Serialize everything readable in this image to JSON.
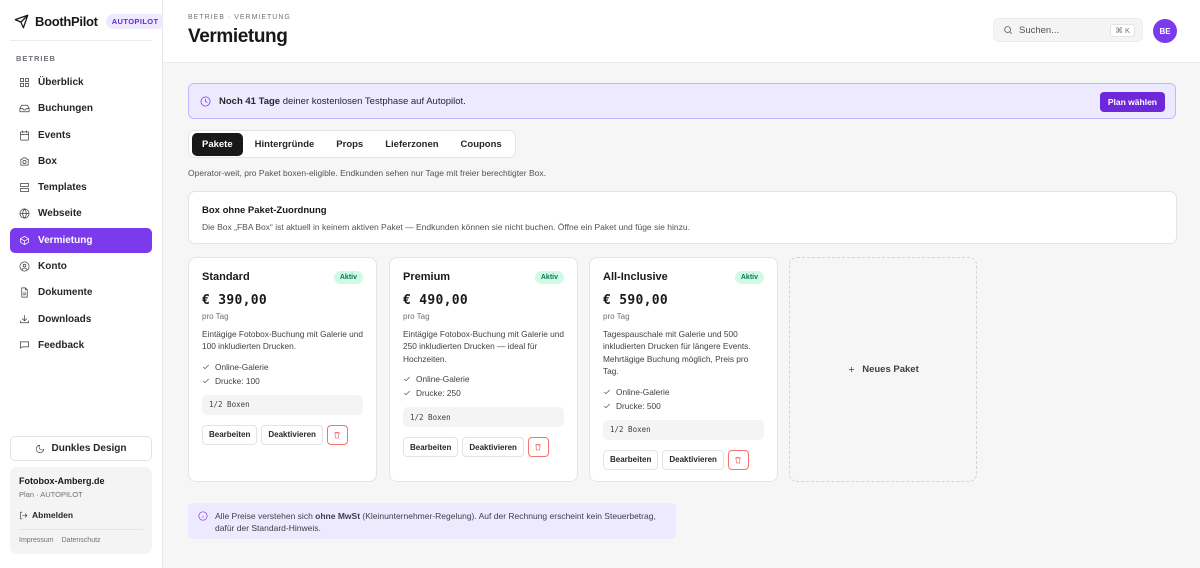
{
  "brand": {
    "name": "BoothPilot",
    "badge": "AUTOPILOT"
  },
  "sidebar": {
    "section": "BETRIEB",
    "items": [
      {
        "label": "Überblick",
        "icon": "grid-icon"
      },
      {
        "label": "Buchungen",
        "icon": "inbox-icon"
      },
      {
        "label": "Events",
        "icon": "calendar-icon"
      },
      {
        "label": "Box",
        "icon": "camera-icon"
      },
      {
        "label": "Templates",
        "icon": "layout-icon"
      },
      {
        "label": "Webseite",
        "icon": "globe-icon"
      },
      {
        "label": "Vermietung",
        "icon": "package-icon",
        "active": true
      },
      {
        "label": "Konto",
        "icon": "user-icon"
      },
      {
        "label": "Dokumente",
        "icon": "file-icon"
      },
      {
        "label": "Downloads",
        "icon": "download-icon"
      },
      {
        "label": "Feedback",
        "icon": "message-icon"
      }
    ],
    "dark_mode_label": "Dunkles Design",
    "account": {
      "name": "Fotobox-Amberg.de",
      "plan": "Plan · AUTOPILOT",
      "logout": "Abmelden",
      "links": [
        "Impressum",
        "Datenschutz"
      ]
    }
  },
  "header": {
    "breadcrumb": "BETRIEB · VERMIETUNG",
    "title": "Vermietung",
    "search_placeholder": "Suchen...",
    "shortcut": "⌘ K",
    "avatar": "BE"
  },
  "trial": {
    "bold": "Noch 41 Tage",
    "text": " deiner kostenlosen Testphase auf Autopilot.",
    "button": "Plan wählen"
  },
  "tabs": [
    "Pakete",
    "Hintergründe",
    "Props",
    "Lieferzonen",
    "Coupons"
  ],
  "active_tab": "Pakete",
  "tab_description": "Operator-weit, pro Paket boxen-eligible. Endkunden sehen nur Tage mit freier berechtigter Box.",
  "notice": {
    "title": "Box ohne Paket-Zuordnung",
    "text": "Die Box „FBA Box“ ist aktuell in keinem aktiven Paket — Endkunden können sie nicht buchen. Öffne ein Paket und füge sie hinzu."
  },
  "packages": [
    {
      "name": "Standard",
      "status": "Aktiv",
      "price": "€ 390,00",
      "unit": "pro Tag",
      "description": "Eintägige Fotobox-Buchung mit Galerie und 100 inkludierten Drucken.",
      "features": [
        "Online-Galerie",
        "Drucke: 100"
      ],
      "boxes": "1/2 Boxen"
    },
    {
      "name": "Premium",
      "status": "Aktiv",
      "price": "€ 490,00",
      "unit": "pro Tag",
      "description": "Eintägige Fotobox-Buchung mit Galerie und 250 inkludierten Drucken — ideal für Hochzeiten.",
      "features": [
        "Online-Galerie",
        "Drucke: 250"
      ],
      "boxes": "1/2 Boxen"
    },
    {
      "name": "All-Inclusive",
      "status": "Aktiv",
      "price": "€ 590,00",
      "unit": "pro Tag",
      "description": "Tagespauschale mit Galerie und 500 inkludierten Drucken für längere Events. Mehrtägige Buchung möglich, Preis pro Tag.",
      "features": [
        "Online-Galerie",
        "Drucke: 500"
      ],
      "boxes": "1/2 Boxen"
    }
  ],
  "card_actions": {
    "edit": "Bearbeiten",
    "deactivate": "Deaktivieren"
  },
  "new_package": "Neues Paket",
  "vat_note": {
    "pre": "Alle Preise verstehen sich ",
    "bold": "ohne MwSt",
    "post": " (Kleinunternehmer-Regelung). Auf der Rechnung erscheint kein Steuerbetrag, dafür der Standard-Hinweis."
  },
  "colors": {
    "accent": "#7c3aed",
    "active_badge_bg": "#d1fae5",
    "active_badge_text": "#047857",
    "danger": "#ef4444"
  }
}
